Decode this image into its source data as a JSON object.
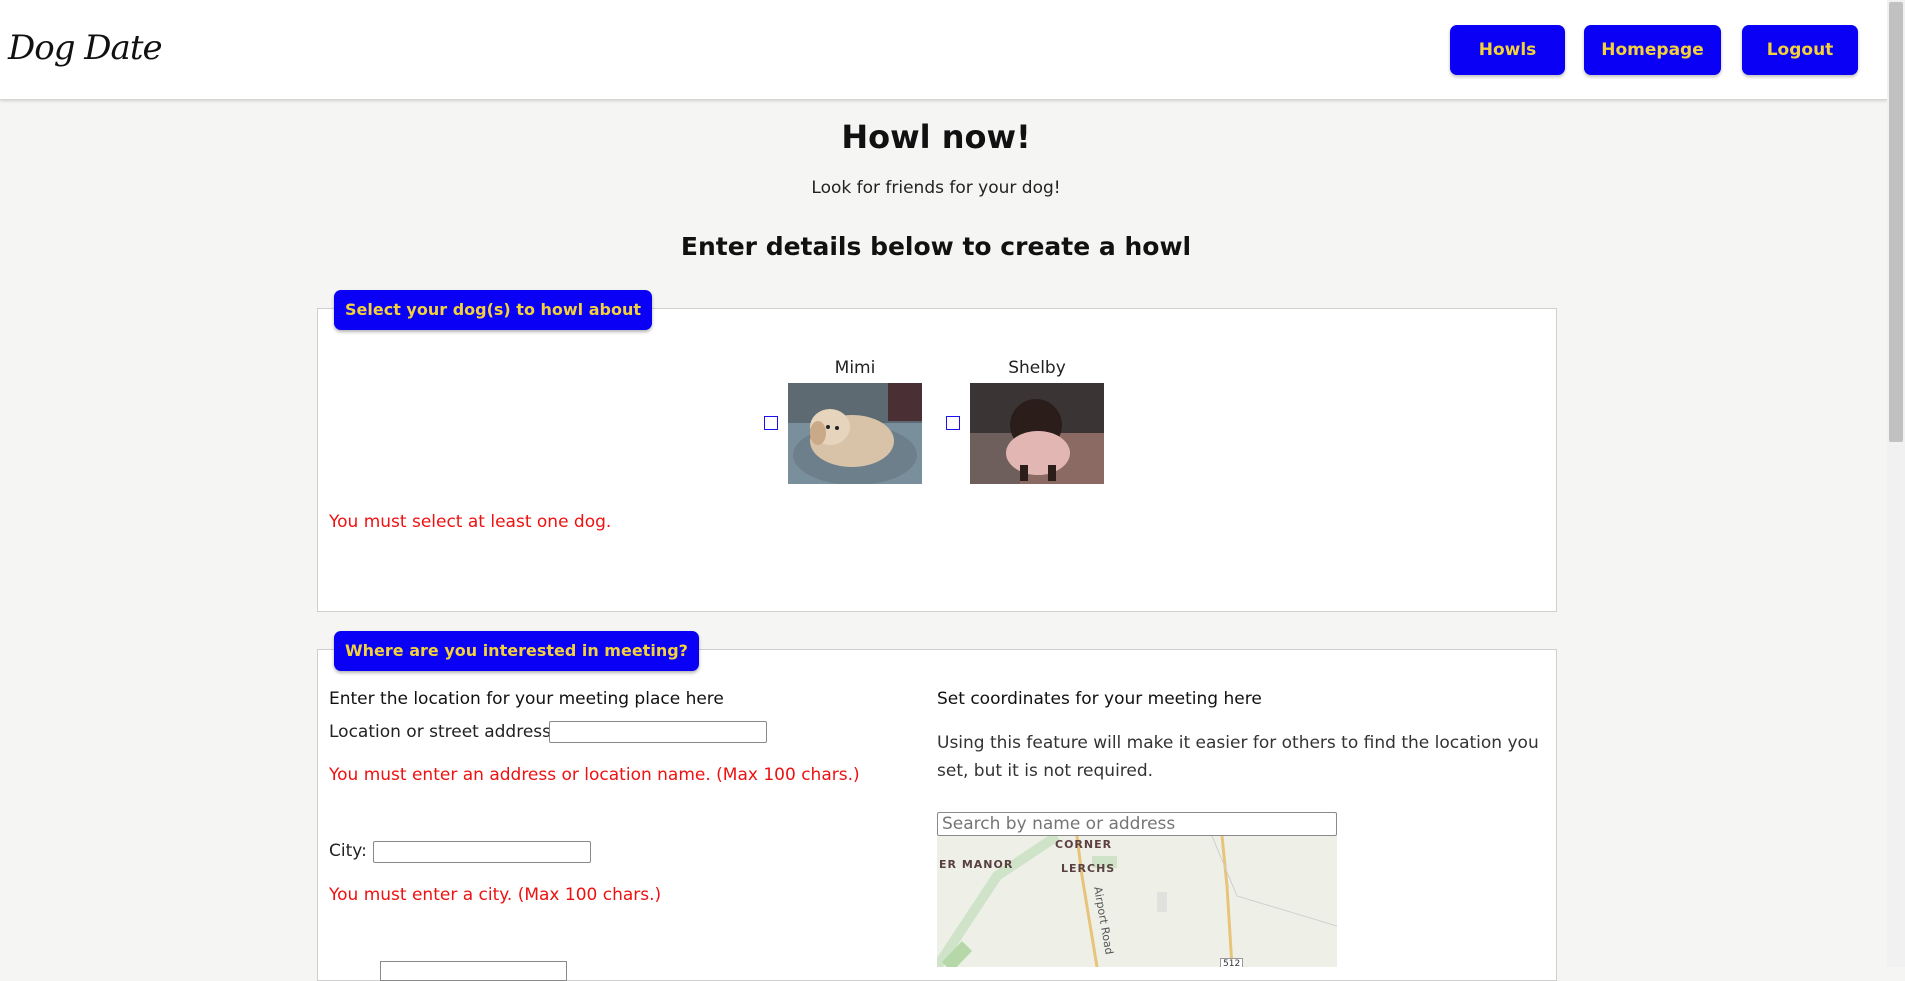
{
  "header": {
    "logo": "Dog Date",
    "nav": {
      "howls": "Howls",
      "homepage": "Homepage",
      "logout": "Logout"
    }
  },
  "main": {
    "title": "Howl now!",
    "subtitle": "Look for friends for your dog!",
    "heading": "Enter details below to create a howl"
  },
  "dogs_section": {
    "legend": "Select your dog(s) to howl about",
    "dogs": [
      {
        "name": "Mimi",
        "checked": false
      },
      {
        "name": "Shelby",
        "checked": false
      }
    ],
    "error": "You must select at least one dog."
  },
  "location_section": {
    "legend": "Where are you interested in meeting?",
    "left_heading": "Enter the location for your meeting place here",
    "address_label": "Location or street address:",
    "address_value": "",
    "address_error": "You must enter an address or location name. (Max 100 chars.)",
    "city_label": "City:",
    "city_value": "",
    "city_error": "You must enter a city. (Max 100 chars.)",
    "right_heading": "Set coordinates for your meeting here",
    "help_text": "Using this feature will make it easier for others to find the location you set, but it is not required.",
    "map_search_placeholder": "Search by name or address",
    "map_labels": [
      "CORNER",
      "ER MANOR",
      "LERCHS",
      "Airport Road",
      "512"
    ]
  },
  "colors": {
    "accent": "#0a00f5",
    "button_text": "#f2d13a",
    "error": "#ee1111",
    "background": "#f5f5f3"
  }
}
